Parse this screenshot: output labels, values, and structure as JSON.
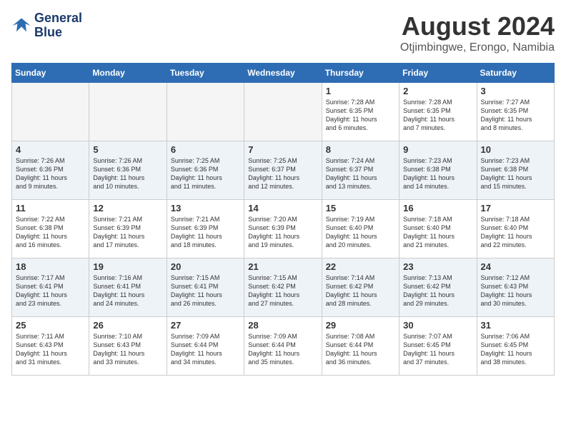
{
  "header": {
    "logo_line1": "General",
    "logo_line2": "Blue",
    "month_year": "August 2024",
    "location": "Otjimbingwe, Erongo, Namibia"
  },
  "days_of_week": [
    "Sunday",
    "Monday",
    "Tuesday",
    "Wednesday",
    "Thursday",
    "Friday",
    "Saturday"
  ],
  "weeks": [
    [
      {
        "num": "",
        "info": "",
        "empty": true
      },
      {
        "num": "",
        "info": "",
        "empty": true
      },
      {
        "num": "",
        "info": "",
        "empty": true
      },
      {
        "num": "",
        "info": "",
        "empty": true
      },
      {
        "num": "1",
        "info": "Sunrise: 7:28 AM\nSunset: 6:35 PM\nDaylight: 11 hours\nand 6 minutes.",
        "empty": false
      },
      {
        "num": "2",
        "info": "Sunrise: 7:28 AM\nSunset: 6:35 PM\nDaylight: 11 hours\nand 7 minutes.",
        "empty": false
      },
      {
        "num": "3",
        "info": "Sunrise: 7:27 AM\nSunset: 6:35 PM\nDaylight: 11 hours\nand 8 minutes.",
        "empty": false
      }
    ],
    [
      {
        "num": "4",
        "info": "Sunrise: 7:26 AM\nSunset: 6:36 PM\nDaylight: 11 hours\nand 9 minutes.",
        "empty": false
      },
      {
        "num": "5",
        "info": "Sunrise: 7:26 AM\nSunset: 6:36 PM\nDaylight: 11 hours\nand 10 minutes.",
        "empty": false
      },
      {
        "num": "6",
        "info": "Sunrise: 7:25 AM\nSunset: 6:36 PM\nDaylight: 11 hours\nand 11 minutes.",
        "empty": false
      },
      {
        "num": "7",
        "info": "Sunrise: 7:25 AM\nSunset: 6:37 PM\nDaylight: 11 hours\nand 12 minutes.",
        "empty": false
      },
      {
        "num": "8",
        "info": "Sunrise: 7:24 AM\nSunset: 6:37 PM\nDaylight: 11 hours\nand 13 minutes.",
        "empty": false
      },
      {
        "num": "9",
        "info": "Sunrise: 7:23 AM\nSunset: 6:38 PM\nDaylight: 11 hours\nand 14 minutes.",
        "empty": false
      },
      {
        "num": "10",
        "info": "Sunrise: 7:23 AM\nSunset: 6:38 PM\nDaylight: 11 hours\nand 15 minutes.",
        "empty": false
      }
    ],
    [
      {
        "num": "11",
        "info": "Sunrise: 7:22 AM\nSunset: 6:38 PM\nDaylight: 11 hours\nand 16 minutes.",
        "empty": false
      },
      {
        "num": "12",
        "info": "Sunrise: 7:21 AM\nSunset: 6:39 PM\nDaylight: 11 hours\nand 17 minutes.",
        "empty": false
      },
      {
        "num": "13",
        "info": "Sunrise: 7:21 AM\nSunset: 6:39 PM\nDaylight: 11 hours\nand 18 minutes.",
        "empty": false
      },
      {
        "num": "14",
        "info": "Sunrise: 7:20 AM\nSunset: 6:39 PM\nDaylight: 11 hours\nand 19 minutes.",
        "empty": false
      },
      {
        "num": "15",
        "info": "Sunrise: 7:19 AM\nSunset: 6:40 PM\nDaylight: 11 hours\nand 20 minutes.",
        "empty": false
      },
      {
        "num": "16",
        "info": "Sunrise: 7:18 AM\nSunset: 6:40 PM\nDaylight: 11 hours\nand 21 minutes.",
        "empty": false
      },
      {
        "num": "17",
        "info": "Sunrise: 7:18 AM\nSunset: 6:40 PM\nDaylight: 11 hours\nand 22 minutes.",
        "empty": false
      }
    ],
    [
      {
        "num": "18",
        "info": "Sunrise: 7:17 AM\nSunset: 6:41 PM\nDaylight: 11 hours\nand 23 minutes.",
        "empty": false
      },
      {
        "num": "19",
        "info": "Sunrise: 7:16 AM\nSunset: 6:41 PM\nDaylight: 11 hours\nand 24 minutes.",
        "empty": false
      },
      {
        "num": "20",
        "info": "Sunrise: 7:15 AM\nSunset: 6:41 PM\nDaylight: 11 hours\nand 26 minutes.",
        "empty": false
      },
      {
        "num": "21",
        "info": "Sunrise: 7:15 AM\nSunset: 6:42 PM\nDaylight: 11 hours\nand 27 minutes.",
        "empty": false
      },
      {
        "num": "22",
        "info": "Sunrise: 7:14 AM\nSunset: 6:42 PM\nDaylight: 11 hours\nand 28 minutes.",
        "empty": false
      },
      {
        "num": "23",
        "info": "Sunrise: 7:13 AM\nSunset: 6:42 PM\nDaylight: 11 hours\nand 29 minutes.",
        "empty": false
      },
      {
        "num": "24",
        "info": "Sunrise: 7:12 AM\nSunset: 6:43 PM\nDaylight: 11 hours\nand 30 minutes.",
        "empty": false
      }
    ],
    [
      {
        "num": "25",
        "info": "Sunrise: 7:11 AM\nSunset: 6:43 PM\nDaylight: 11 hours\nand 31 minutes.",
        "empty": false
      },
      {
        "num": "26",
        "info": "Sunrise: 7:10 AM\nSunset: 6:43 PM\nDaylight: 11 hours\nand 33 minutes.",
        "empty": false
      },
      {
        "num": "27",
        "info": "Sunrise: 7:09 AM\nSunset: 6:44 PM\nDaylight: 11 hours\nand 34 minutes.",
        "empty": false
      },
      {
        "num": "28",
        "info": "Sunrise: 7:09 AM\nSunset: 6:44 PM\nDaylight: 11 hours\nand 35 minutes.",
        "empty": false
      },
      {
        "num": "29",
        "info": "Sunrise: 7:08 AM\nSunset: 6:44 PM\nDaylight: 11 hours\nand 36 minutes.",
        "empty": false
      },
      {
        "num": "30",
        "info": "Sunrise: 7:07 AM\nSunset: 6:45 PM\nDaylight: 11 hours\nand 37 minutes.",
        "empty": false
      },
      {
        "num": "31",
        "info": "Sunrise: 7:06 AM\nSunset: 6:45 PM\nDaylight: 11 hours\nand 38 minutes.",
        "empty": false
      }
    ]
  ]
}
